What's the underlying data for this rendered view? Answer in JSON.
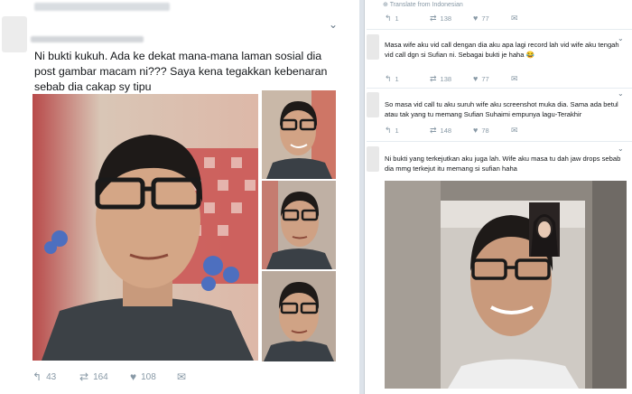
{
  "left_tweet": {
    "text": "Ni bukti kukuh. Ada ke dekat mana-mana laman sosial dia post gambar macam ni??? Saya kena tegakkan kebenaran sebab dia cakap sy tipu",
    "reply_count": "43",
    "retweet_count": "164",
    "like_count": "108"
  },
  "right_thread": {
    "translate_label": "Translate from Indonesian",
    "top_actions": {
      "reply_count": "1",
      "retweet_count": "138",
      "like_count": "77"
    },
    "replies": [
      {
        "text": "Masa wife aku vid call dengan dia aku apa lagi record lah vid wife aku tengah vid call dgn si Sufian ni. Sebagai bukti je haha 😂",
        "reply_count": "1",
        "retweet_count": "138",
        "like_count": "77"
      },
      {
        "text": "So masa vid call tu aku suruh wife aku screenshot muka dia. Sama ada betul atau tak yang tu memang Sufian Suhaimi empunya lagu-Terakhir",
        "reply_count": "1",
        "retweet_count": "148",
        "like_count": "78"
      },
      {
        "text": "Ni bukti yang terkejutkan aku juga lah. Wife aku masa tu dah jaw drops sebab dia mmg terkejut itu memang si sufian haha"
      }
    ]
  },
  "icons": {
    "reply": "reply-icon",
    "retweet": "retweet-icon",
    "like": "heart-icon",
    "message": "direct-message-icon",
    "more": "chevron-down-icon",
    "globe": "globe-icon"
  },
  "colors": {
    "text": "#14171a",
    "muted": "#8899a6",
    "divider": "#dde3ea"
  }
}
